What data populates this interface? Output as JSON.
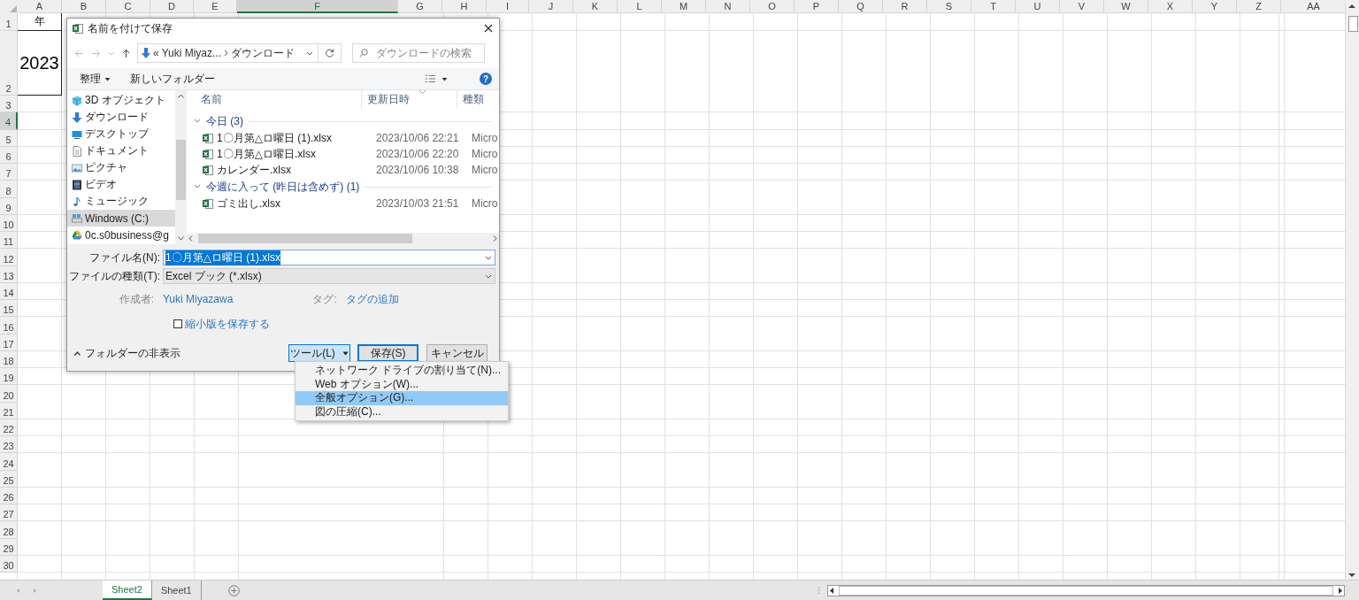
{
  "sheet": {
    "columns": [
      {
        "label": "A",
        "selected": false
      },
      {
        "label": "B",
        "selected": false
      },
      {
        "label": "C",
        "selected": false
      },
      {
        "label": "D",
        "selected": false
      },
      {
        "label": "E",
        "selected": false
      },
      {
        "label": "F",
        "selected": true
      },
      {
        "label": "G",
        "selected": false
      },
      {
        "label": "H",
        "selected": false
      },
      {
        "label": "I",
        "selected": false
      },
      {
        "label": "J",
        "selected": false
      },
      {
        "label": "K",
        "selected": false
      },
      {
        "label": "L",
        "selected": false
      },
      {
        "label": "M",
        "selected": false
      },
      {
        "label": "N",
        "selected": false
      },
      {
        "label": "O",
        "selected": false
      },
      {
        "label": "P",
        "selected": false
      },
      {
        "label": "Q",
        "selected": false
      },
      {
        "label": "R",
        "selected": false
      },
      {
        "label": "S",
        "selected": false
      },
      {
        "label": "T",
        "selected": false
      },
      {
        "label": "U",
        "selected": false
      },
      {
        "label": "V",
        "selected": false
      },
      {
        "label": "W",
        "selected": false
      },
      {
        "label": "X",
        "selected": false
      },
      {
        "label": "Y",
        "selected": false
      },
      {
        "label": "Z",
        "selected": false
      },
      {
        "label": "AA",
        "selected": false
      }
    ],
    "rows": [
      {
        "label": "1",
        "selected": false,
        "cells": [
          "年"
        ]
      },
      {
        "label": "2",
        "selected": false,
        "cells": [
          "2023"
        ]
      },
      {
        "label": "3",
        "selected": false
      },
      {
        "label": "4",
        "selected": true
      },
      {
        "label": "5",
        "selected": false
      },
      {
        "label": "6",
        "selected": false
      },
      {
        "label": "7",
        "selected": false
      },
      {
        "label": "8",
        "selected": false
      },
      {
        "label": "9",
        "selected": false
      },
      {
        "label": "10",
        "selected": false
      },
      {
        "label": "11",
        "selected": false
      },
      {
        "label": "12",
        "selected": false
      },
      {
        "label": "13",
        "selected": false
      },
      {
        "label": "14",
        "selected": false
      },
      {
        "label": "15",
        "selected": false
      },
      {
        "label": "16",
        "selected": false
      },
      {
        "label": "17",
        "selected": false
      },
      {
        "label": "18",
        "selected": false
      },
      {
        "label": "19",
        "selected": false
      },
      {
        "label": "20",
        "selected": false
      },
      {
        "label": "21",
        "selected": false
      },
      {
        "label": "22",
        "selected": false
      },
      {
        "label": "23",
        "selected": false
      },
      {
        "label": "24",
        "selected": false
      },
      {
        "label": "25",
        "selected": false
      },
      {
        "label": "26",
        "selected": false
      },
      {
        "label": "27",
        "selected": false
      },
      {
        "label": "28",
        "selected": false
      },
      {
        "label": "29",
        "selected": false
      },
      {
        "label": "30",
        "selected": false
      }
    ]
  },
  "sheet_tabs": [
    {
      "label": "Sheet2",
      "selected": true
    },
    {
      "label": "Sheet1",
      "selected": false
    }
  ],
  "dialog": {
    "title": "名前を付けて保存",
    "address": {
      "overflow": "«",
      "path": [
        "Yuki Miyaz...",
        "ダウンロード"
      ]
    },
    "search": {
      "placeholder": "ダウンロードの検索"
    },
    "toolbar": {
      "organize": "整理",
      "new_folder": "新しいフォルダー",
      "help": "?"
    },
    "sidebar": {
      "items": [
        {
          "label": "3D オブジェクト",
          "kind": "cube",
          "selected": false
        },
        {
          "label": "ダウンロード",
          "kind": "download",
          "selected": false
        },
        {
          "label": "デスクトップ",
          "kind": "desktop",
          "selected": false
        },
        {
          "label": "ドキュメント",
          "kind": "document",
          "selected": false
        },
        {
          "label": "ピクチャ",
          "kind": "picture",
          "selected": false
        },
        {
          "label": "ビデオ",
          "kind": "video",
          "selected": false
        },
        {
          "label": "ミュージック",
          "kind": "music",
          "selected": false
        },
        {
          "label": "Windows (C:)",
          "kind": "drive",
          "selected": true
        },
        {
          "label": "0c.s0business@g",
          "kind": "cloud",
          "selected": false
        }
      ]
    },
    "columns": [
      "名前",
      "更新日時",
      "種類"
    ],
    "groups": [
      {
        "label": "今日 (3)",
        "files": [
          {
            "name": "1〇月第△ロ曜日 (1).xlsx",
            "modified": "2023/10/06 22:21",
            "type": "Micro"
          },
          {
            "name": "1〇月第△ロ曜日.xlsx",
            "modified": "2023/10/06 22:20",
            "type": "Micro"
          },
          {
            "name": "カレンダー.xlsx",
            "modified": "2023/10/06 10:38",
            "type": "Micro"
          }
        ]
      },
      {
        "label": "今週に入って (昨日は含めず) (1)",
        "files": [
          {
            "name": "ゴミ出し.xlsx",
            "modified": "2023/10/03 21:51",
            "type": "Micro"
          }
        ]
      }
    ],
    "file_name": {
      "label": "ファイル名(N):",
      "value": "1〇月第△ロ曜日 (1).xlsx"
    },
    "file_type": {
      "label": "ファイルの種類(T):",
      "value": "Excel ブック (*.xlsx)"
    },
    "author": {
      "label": "作成者:",
      "value": "Yuki Miyazawa"
    },
    "tags": {
      "label": "タグ:",
      "value": "タグの追加"
    },
    "thumbnail": {
      "label": "縮小版を保存する",
      "checked": false
    },
    "hide_folders": "フォルダーの非表示",
    "buttons": {
      "tools": "ツール(L)",
      "save": "保存(S)",
      "cancel": "キャンセル"
    }
  },
  "menu": {
    "items": [
      {
        "label": "ネットワーク ドライブの割り当て(N)...",
        "selected": false
      },
      {
        "label": "Web オプション(W)...",
        "selected": false
      },
      {
        "label": "全般オプション(G)...",
        "selected": true
      },
      {
        "label": "図の圧縮(C)...",
        "selected": false
      }
    ]
  }
}
